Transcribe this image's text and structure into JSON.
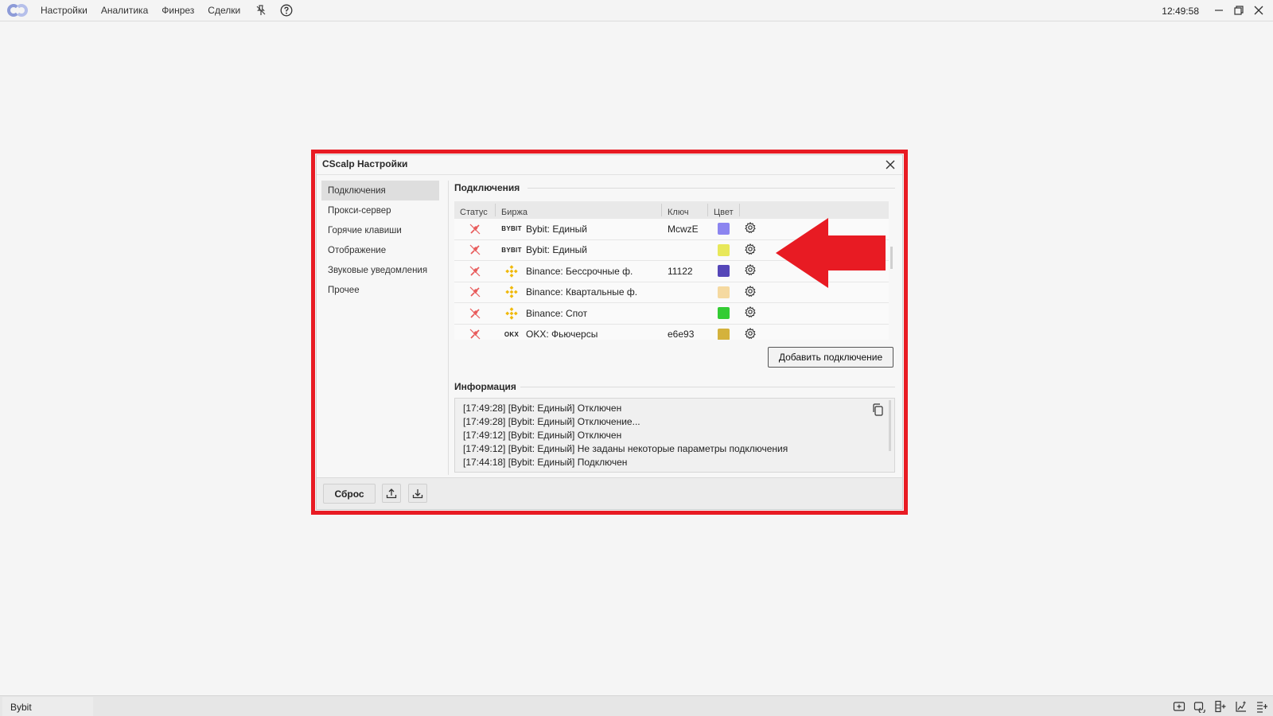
{
  "topbar": {
    "menu": [
      "Настройки",
      "Аналитика",
      "Финрез",
      "Сделки"
    ],
    "icons": [
      "pin-off-icon",
      "help-icon"
    ],
    "clock": "12:49:58",
    "window_buttons": [
      "minimize-icon",
      "restore-icon",
      "close-icon"
    ]
  },
  "dialog": {
    "title": "CScalp Настройки",
    "nav": [
      "Подключения",
      "Прокси-сервер",
      "Горячие клавиши",
      "Отображение",
      "Звуковые уведомления",
      "Прочее"
    ],
    "active_nav": "Подключения",
    "connections": {
      "title": "Подключения",
      "columns": [
        "Статус",
        "Биржа",
        "Ключ",
        "Цвет"
      ],
      "rows": [
        {
          "logo": "BYBIT",
          "exchange": "Bybit: Единый",
          "key": "McwzE",
          "color": "#8c85f0"
        },
        {
          "logo": "BYBIT",
          "exchange": "Bybit: Единый",
          "key": "",
          "color": "#e8e85a"
        },
        {
          "logo": "binance",
          "exchange": "Binance: Бессрочные ф.",
          "key": "11122",
          "color": "#5546b8"
        },
        {
          "logo": "binance",
          "exchange": "Binance: Квартальные ф.",
          "key": "",
          "color": "#f5d9a0"
        },
        {
          "logo": "binance",
          "exchange": "Binance: Спот",
          "key": "",
          "color": "#33cc33"
        },
        {
          "logo": "OKX",
          "exchange": "OKX: Фьючерсы",
          "key": "e6e93",
          "color": "#d4b23c"
        }
      ],
      "add_button": "Добавить подключение"
    },
    "info": {
      "title": "Информация",
      "lines": [
        "[17:49:28] [Bybit: Единый] Отключен",
        "[17:49:28] [Bybit: Единый] Отключение...",
        "[17:49:12] [Bybit: Единый] Отключен",
        "[17:49:12] [Bybit: Единый] Не заданы некоторые параметры подключения",
        "[17:44:18] [Bybit: Единый] Подключен"
      ]
    },
    "footer": {
      "reset": "Сброс"
    }
  },
  "statusbar": {
    "tab": "Bybit"
  },
  "colors": {
    "highlight": "#e81b23",
    "arrow": "#e81b23",
    "disconnected_status": "#e85c5c"
  }
}
